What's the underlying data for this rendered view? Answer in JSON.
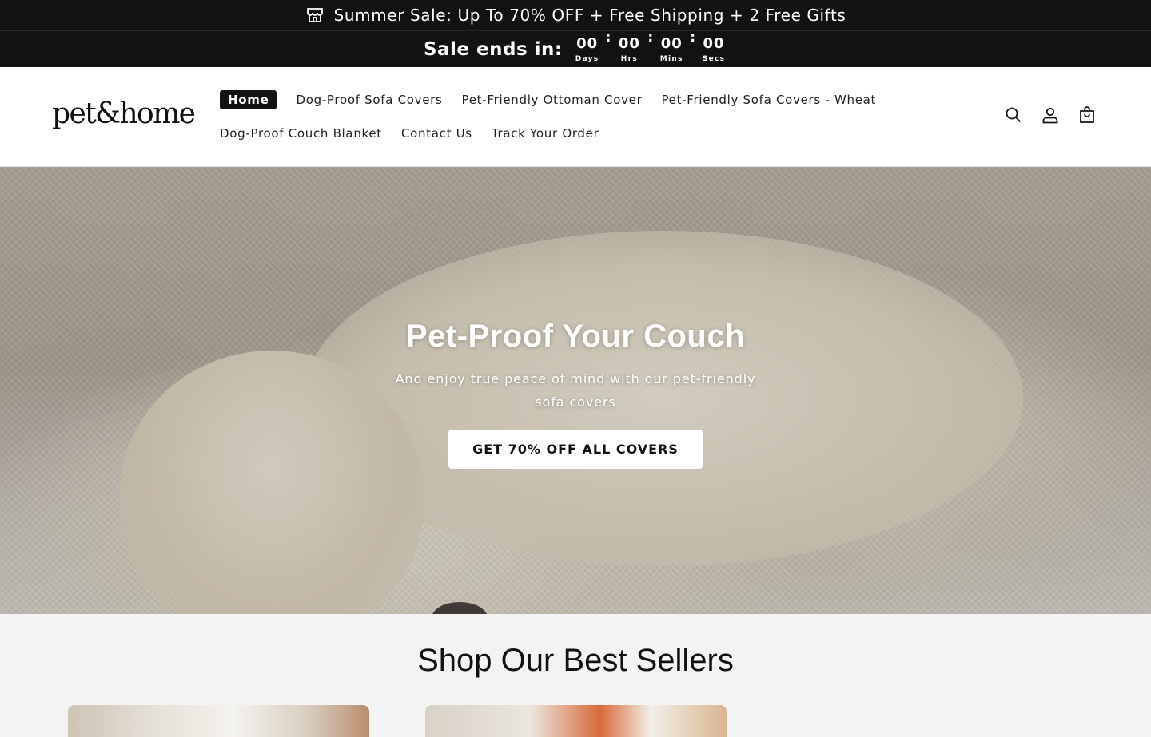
{
  "announcement": {
    "icon": "store-icon",
    "text": "Summer Sale: Up To 70% OFF + Free Shipping + 2 Free Gifts"
  },
  "countdown": {
    "label": "Sale ends in:",
    "separator": ":",
    "units": [
      {
        "value": "00",
        "label": "Days"
      },
      {
        "value": "00",
        "label": "Hrs"
      },
      {
        "value": "00",
        "label": "Mins"
      },
      {
        "value": "00",
        "label": "Secs"
      }
    ]
  },
  "header": {
    "logo": "pet&home",
    "nav": [
      {
        "label": "Home",
        "active": true
      },
      {
        "label": "Dog-Proof Sofa Covers"
      },
      {
        "label": "Pet-Friendly Ottoman Cover"
      },
      {
        "label": "Pet-Friendly Sofa Covers - Wheat"
      },
      {
        "label": "Dog-Proof Couch Blanket"
      },
      {
        "label": "Contact Us"
      },
      {
        "label": "Track Your Order"
      }
    ],
    "icons": [
      "search-icon",
      "account-icon",
      "cart-icon"
    ]
  },
  "hero": {
    "title": "Pet-Proof Your Couch",
    "subtitle": "And enjoy true peace of mind with our pet-friendly sofa covers",
    "button": "GET 70% OFF ALL COVERS"
  },
  "best_sellers": {
    "title": "Shop Our Best Sellers"
  },
  "colors": {
    "bar_bg": "#121212",
    "accent": "#121212",
    "page_bg": "#f3f3f3"
  }
}
